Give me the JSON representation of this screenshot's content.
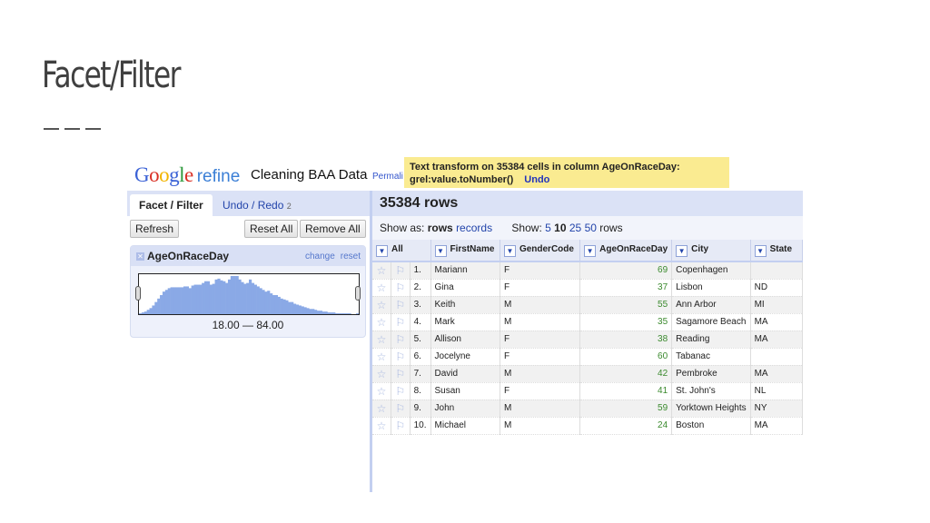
{
  "slide": {
    "title": "Facet/Filter"
  },
  "app": {
    "logo_google": "Google",
    "logo_refine": "refine",
    "project_name": "Cleaning BAA Data",
    "permalink": "Permali",
    "notice": {
      "line1": "Text transform on 35384 cells in column AgeOnRaceDay:",
      "line2": "grel:value.toNumber()",
      "undo": "Undo"
    },
    "tabs": [
      {
        "label": "Facet / Filter",
        "active": true
      },
      {
        "label": "Undo / Redo",
        "badge": "2",
        "active": false
      }
    ],
    "buttons": {
      "refresh": "Refresh",
      "reset_all": "Reset All",
      "remove_all": "Remove All"
    },
    "facet": {
      "name": "AgeOnRaceDay",
      "change": "change",
      "reset": "reset",
      "range": "18.00 — 84.00",
      "histogram": [
        1,
        2,
        3,
        5,
        7,
        10,
        14,
        18,
        22,
        26,
        28,
        30,
        31,
        31,
        31,
        31,
        31,
        32,
        32,
        30,
        33,
        34,
        34,
        34,
        36,
        38,
        38,
        34,
        35,
        40,
        41,
        39,
        38,
        36,
        40,
        44,
        44,
        44,
        40,
        37,
        35,
        36,
        40,
        36,
        34,
        32,
        30,
        28,
        26,
        27,
        24,
        22,
        22,
        20,
        18,
        17,
        16,
        14,
        14,
        12,
        11,
        10,
        9,
        8,
        7,
        6,
        6,
        5,
        4,
        4,
        3,
        3,
        2,
        2,
        2,
        1,
        1,
        1,
        1,
        1,
        1,
        0,
        0,
        1
      ]
    },
    "grid": {
      "row_count": "35384 rows",
      "show_as_label": "Show as:",
      "show_as_rows": "rows",
      "show_as_records": "records",
      "show_label": "Show:",
      "page_sizes": [
        "5",
        "10",
        "25",
        "50"
      ],
      "page_size_selected": "10",
      "rows_suffix": "rows",
      "columns": [
        "All",
        "FirstName",
        "GenderCode",
        "AgeOnRaceDay",
        "City",
        "State"
      ],
      "rows": [
        {
          "n": "1.",
          "first": "Mariann",
          "gender": "F",
          "age": "69",
          "city": "Copenhagen",
          "state": ""
        },
        {
          "n": "2.",
          "first": "Gina",
          "gender": "F",
          "age": "37",
          "city": "Lisbon",
          "state": "ND"
        },
        {
          "n": "3.",
          "first": "Keith",
          "gender": "M",
          "age": "55",
          "city": "Ann Arbor",
          "state": "MI"
        },
        {
          "n": "4.",
          "first": "Mark",
          "gender": "M",
          "age": "35",
          "city": "Sagamore Beach",
          "state": "MA"
        },
        {
          "n": "5.",
          "first": "Allison",
          "gender": "F",
          "age": "38",
          "city": "Reading",
          "state": "MA"
        },
        {
          "n": "6.",
          "first": "Jocelyne",
          "gender": "F",
          "age": "60",
          "city": "Tabanac",
          "state": ""
        },
        {
          "n": "7.",
          "first": "David",
          "gender": "M",
          "age": "42",
          "city": "Pembroke",
          "state": "MA"
        },
        {
          "n": "8.",
          "first": "Susan",
          "gender": "F",
          "age": "41",
          "city": "St. John's",
          "state": "NL"
        },
        {
          "n": "9.",
          "first": "John",
          "gender": "M",
          "age": "59",
          "city": "Yorktown Heights",
          "state": "NY"
        },
        {
          "n": "10.",
          "first": "Michael",
          "gender": "M",
          "age": "24",
          "city": "Boston",
          "state": "MA"
        }
      ]
    }
  }
}
